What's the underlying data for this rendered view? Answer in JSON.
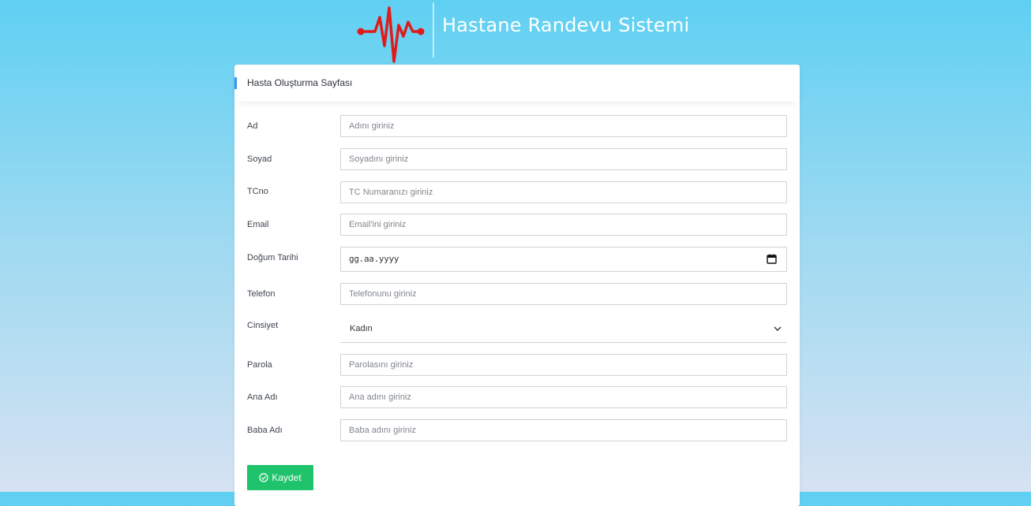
{
  "brand": {
    "title": "Hastane Randevu Sistemi",
    "logo_icon": "heartbeat-icon",
    "logo_color": "#e01b1b"
  },
  "card": {
    "title": "Hasta Oluşturma Sayfası",
    "accent_color": "#3d8ef0"
  },
  "form": {
    "ad": {
      "label": "Ad",
      "placeholder": "Adını giriniz"
    },
    "soyad": {
      "label": "Soyad",
      "placeholder": "Soyadını giriniz"
    },
    "tcno": {
      "label": "TCno",
      "placeholder": "TC Numaranızı giriniz"
    },
    "email": {
      "label": "Email",
      "placeholder": "Email'ini giriniz"
    },
    "dogum": {
      "label": "Doğum Tarihi",
      "value": "gg.aa.yyyy",
      "icon": "calendar-icon"
    },
    "telefon": {
      "label": "Telefon",
      "placeholder": "Telefonunu giriniz"
    },
    "cinsiyet": {
      "label": "Cinsiyet",
      "selected": "Kadın",
      "icon": "chevron-down-icon"
    },
    "parola": {
      "label": "Parola",
      "placeholder": "Parolasını giriniz"
    },
    "ana_adi": {
      "label": "Ana Adı",
      "placeholder": "Ana adını giriniz"
    },
    "baba_adi": {
      "label": "Baba Adı",
      "placeholder": "Baba adını giriniz"
    }
  },
  "actions": {
    "save_label": "Kaydet",
    "save_icon": "check-circle-icon",
    "save_color": "#1fc36b"
  }
}
